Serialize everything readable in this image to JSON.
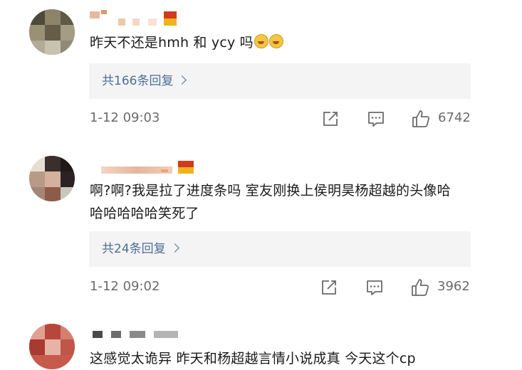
{
  "comments": [
    {
      "text": "昨天不还是hmh 和 ycy  吗",
      "emojis": [
        "laughing-crying-emoji",
        "laughing-crying-emoji"
      ],
      "reply_label": "共166条回复",
      "time": "1-12 09:03",
      "likes": "6742"
    },
    {
      "text": "啊?啊?我是拉了进度条吗 室友刚换上侯明昊杨超越的头像哈哈哈哈哈哈笑死了",
      "reply_label": "共24条回复",
      "time": "1-12 09:02",
      "likes": "3962"
    },
    {
      "text": "这感觉太诡异 昨天和杨超越言情小说成真 今天这个cp"
    }
  ],
  "colors": {
    "reply_link": "#4f6e95",
    "meta_text": "#6b6b6b",
    "reply_bg": "#f4f4f4"
  },
  "icons": [
    "share-icon",
    "comment-icon",
    "like-icon"
  ]
}
